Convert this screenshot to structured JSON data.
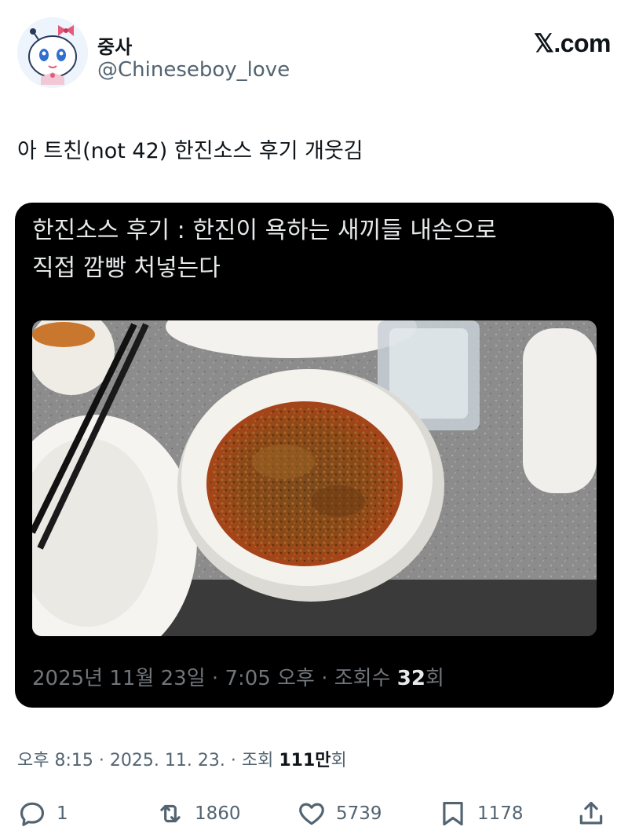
{
  "author": {
    "name": "중사",
    "handle": "@Chineseboy_love"
  },
  "brand": "𝕏.com",
  "tweet": {
    "text": "아 트친(not 42) 한진소스 후기 개웃김",
    "time": "오후 8:15",
    "date": "2025. 11. 23.",
    "views_label": "조회",
    "views_num": "111",
    "views_unit": "만",
    "views_suffix": "회"
  },
  "quoted": {
    "text_line1": "한진소스 후기 : 한진이 욕하는 새끼들 내손으로",
    "text_line2": "직접 깜빵 처넣는다",
    "date": "2025년 11월 23일",
    "time": "7:05 오후",
    "views_label": "조회수",
    "views_num": "32",
    "views_suffix": "회"
  },
  "actions": {
    "replies": "1",
    "retweets": "1860",
    "likes": "5739",
    "bookmarks": "1178"
  },
  "icons": [
    "avatar-character-icon",
    "reply-icon",
    "retweet-icon",
    "like-icon",
    "bookmark-icon",
    "share-icon"
  ]
}
